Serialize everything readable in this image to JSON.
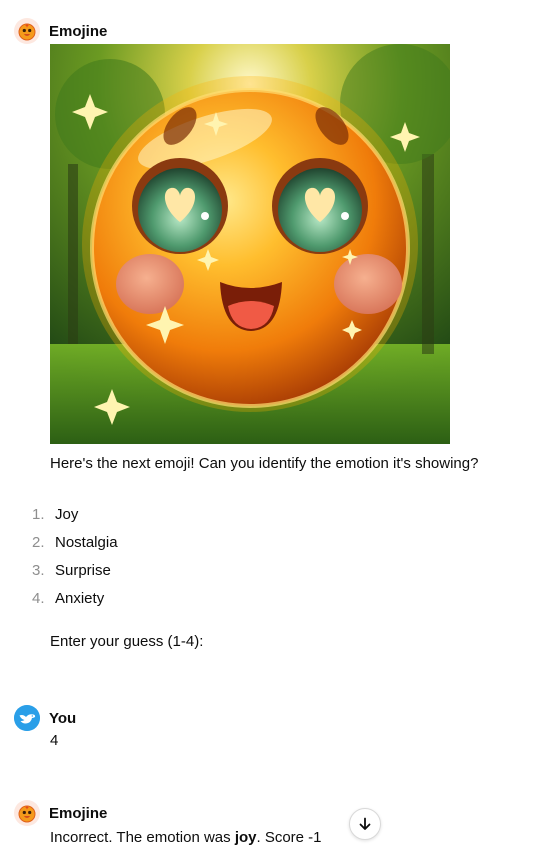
{
  "messages": [
    {
      "author": "Emojine",
      "avatar_icon": "emoji-bot-icon",
      "image_alt": "glowing-heart-eyes-emoji",
      "prompt_text": "Here's the next emoji! Can you identify the emotion it's showing?",
      "options": [
        {
          "num": "1.",
          "label": "Joy"
        },
        {
          "num": "2.",
          "label": "Nostalgia"
        },
        {
          "num": "3.",
          "label": "Surprise"
        },
        {
          "num": "4.",
          "label": "Anxiety"
        }
      ],
      "instruction": "Enter your guess (1-4):"
    },
    {
      "author": "You",
      "avatar_icon": "user-bird-icon",
      "text": "4"
    },
    {
      "author": "Emojine",
      "avatar_icon": "emoji-bot-icon",
      "text_before": "Incorrect. The emotion was ",
      "text_bold": "joy",
      "text_after": ". Score -1"
    }
  ],
  "scroll_button": {
    "icon": "arrow-down-icon"
  },
  "colors": {
    "text": "#0d0d0d",
    "muted_number": "#8e8e8e",
    "user_avatar": "#2a9fe8",
    "bot_avatar": "#fde8e0",
    "emoji_orange": "#f59a1b"
  }
}
